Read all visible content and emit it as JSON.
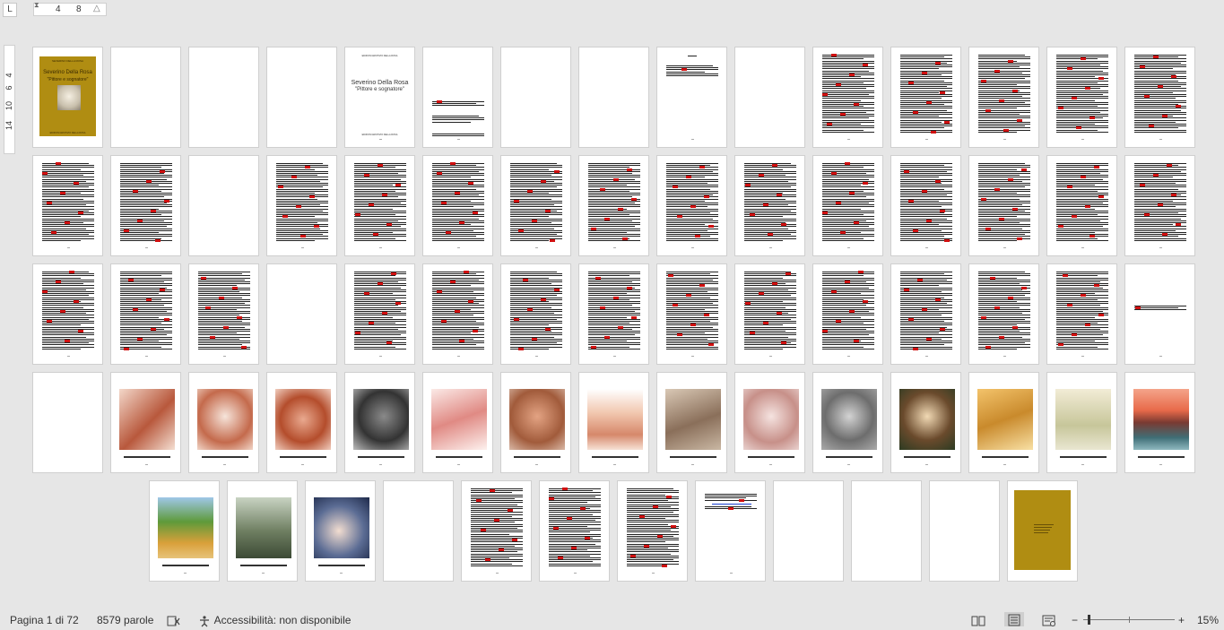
{
  "ruler": {
    "tab_selector": "L",
    "marks": [
      "4",
      "8"
    ],
    "vertical_marks": [
      "4",
      "6",
      "10",
      "14"
    ]
  },
  "doc": {
    "cover_small_caps": "SEVERINO DELLA ROSA",
    "cover_title": "Severino Della Rosa",
    "cover_subtitle": "\"Pittore e sognatore\"",
    "cover_footer": "EDIZIONI ARCHIVIO DELLA ROSA",
    "title_page_header": "EDIZIONI ARCHIVIO DELLA ROSA",
    "title_page_title": "Severino Della Rosa",
    "title_page_subtitle": "\"Pittore e sognatore\"",
    "title_page_footer": "EDIZIONI ARCHIVIO DELLA ROSA"
  },
  "status": {
    "page_info": "Pagina 1 di 72",
    "word_count": "8579 parole",
    "accessibility": "Accessibilità: non disponibile",
    "zoom_level": "15%",
    "zoom_fraction": 0.15,
    "zoom_out": "−",
    "zoom_in": "+"
  },
  "colors": {
    "cover_gold": "#b08d12",
    "proof_red": "#d01010",
    "workspace": "#e6e6e6"
  },
  "pages": [
    {
      "kind": "cover"
    },
    {
      "kind": "blank"
    },
    {
      "kind": "blank"
    },
    {
      "kind": "blank"
    },
    {
      "kind": "title"
    },
    {
      "kind": "colophon"
    },
    {
      "kind": "blank"
    },
    {
      "kind": "blank"
    },
    {
      "kind": "toc"
    },
    {
      "kind": "blank"
    },
    {
      "kind": "text"
    },
    {
      "kind": "text"
    },
    {
      "kind": "text"
    },
    {
      "kind": "text"
    },
    {
      "kind": "text"
    },
    {
      "kind": "text"
    },
    {
      "kind": "text"
    },
    {
      "kind": "blank"
    },
    {
      "kind": "text"
    },
    {
      "kind": "text"
    },
    {
      "kind": "text"
    },
    {
      "kind": "text"
    },
    {
      "kind": "text"
    },
    {
      "kind": "text"
    },
    {
      "kind": "text"
    },
    {
      "kind": "text"
    },
    {
      "kind": "text"
    },
    {
      "kind": "text"
    },
    {
      "kind": "text"
    },
    {
      "kind": "text"
    },
    {
      "kind": "text"
    },
    {
      "kind": "text"
    },
    {
      "kind": "text"
    },
    {
      "kind": "blank"
    },
    {
      "kind": "text"
    },
    {
      "kind": "text"
    },
    {
      "kind": "text"
    },
    {
      "kind": "text"
    },
    {
      "kind": "text"
    },
    {
      "kind": "text"
    },
    {
      "kind": "text"
    },
    {
      "kind": "text"
    },
    {
      "kind": "text"
    },
    {
      "kind": "text"
    },
    {
      "kind": "shorttext"
    },
    {
      "kind": "blank"
    },
    {
      "kind": "image",
      "img": "sketch1"
    },
    {
      "kind": "image",
      "img": "sketch2"
    },
    {
      "kind": "image",
      "img": "sketch3"
    },
    {
      "kind": "image",
      "img": "charcoal"
    },
    {
      "kind": "image",
      "img": "pinkfig"
    },
    {
      "kind": "image",
      "img": "boy"
    },
    {
      "kind": "image",
      "img": "church"
    },
    {
      "kind": "image",
      "img": "couple"
    },
    {
      "kind": "image",
      "img": "pinkface"
    },
    {
      "kind": "image",
      "img": "child"
    },
    {
      "kind": "image",
      "img": "portrait"
    },
    {
      "kind": "image",
      "img": "gold"
    },
    {
      "kind": "image",
      "img": "vase"
    },
    {
      "kind": "image",
      "img": "sunset"
    },
    {
      "kind": "image",
      "img": "tree"
    },
    {
      "kind": "image",
      "img": "forest"
    },
    {
      "kind": "image",
      "img": "woman"
    },
    {
      "kind": "blank"
    },
    {
      "kind": "text"
    },
    {
      "kind": "text"
    },
    {
      "kind": "text"
    },
    {
      "kind": "link"
    },
    {
      "kind": "blank"
    },
    {
      "kind": "blank"
    },
    {
      "kind": "blank"
    },
    {
      "kind": "backcover"
    }
  ]
}
